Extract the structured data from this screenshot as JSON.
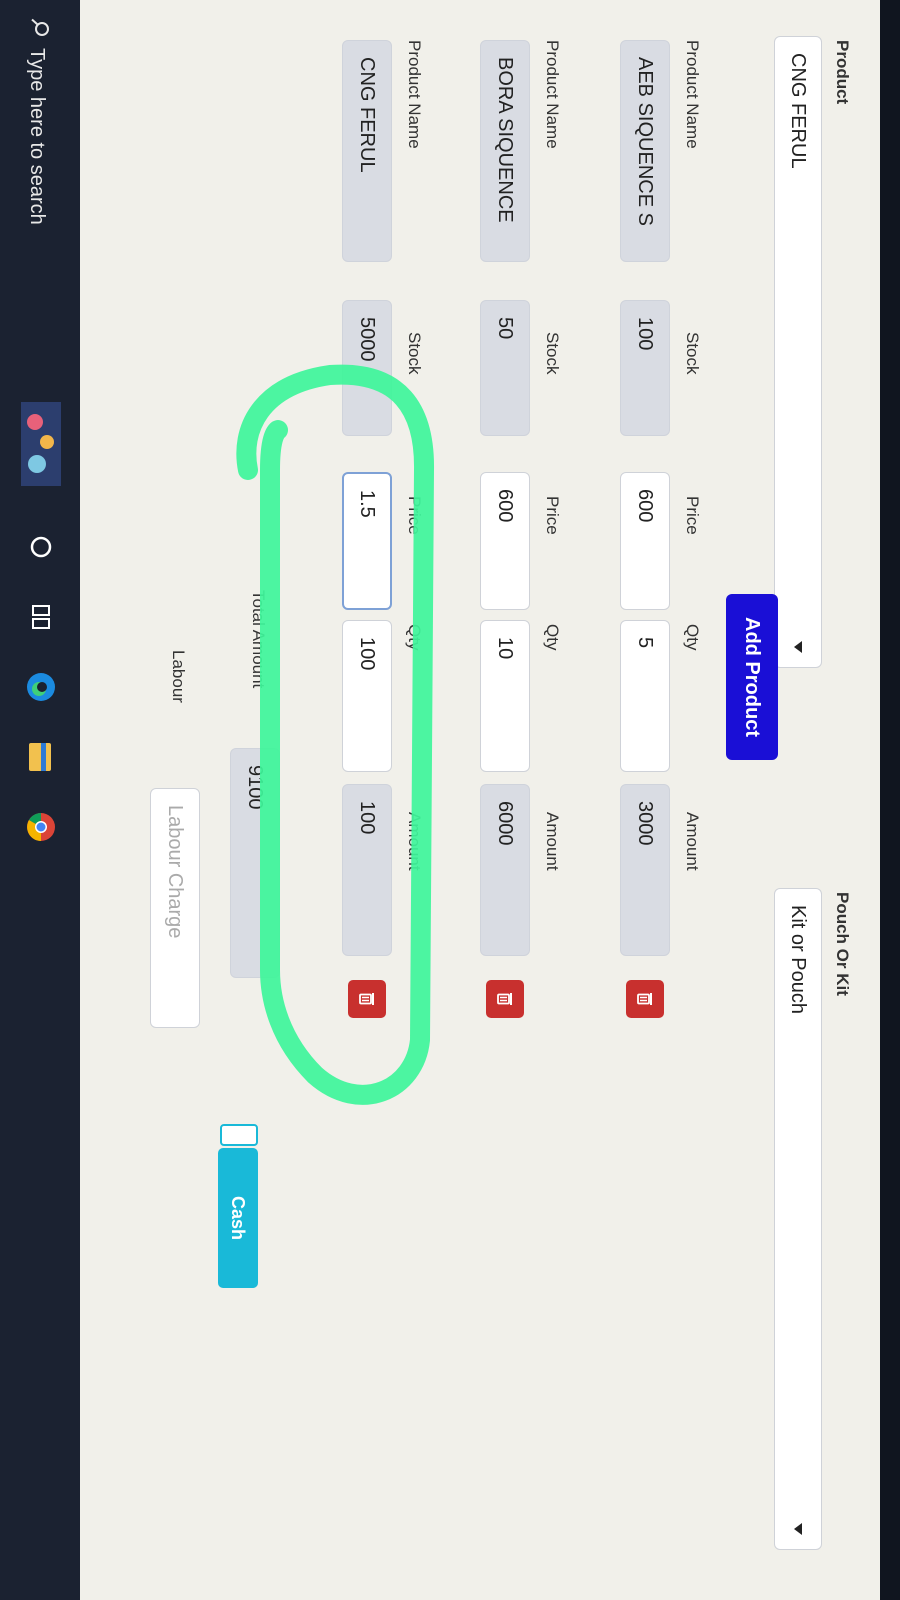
{
  "form": {
    "product_label": "Product",
    "product_value": "CNG FERUL",
    "pouch_label": "Pouch Or Kit",
    "pouch_value": "Kit or Pouch",
    "add_button": "Add Product"
  },
  "columns": {
    "name": "Product Name",
    "stock": "Stock",
    "price": "Price",
    "qty": "Qty",
    "amount": "Amount"
  },
  "rows": [
    {
      "name": "AEB SIQUENCE S",
      "stock": "100",
      "price": "600",
      "qty": "5",
      "amount": "3000"
    },
    {
      "name": "BORA SIQUENCE",
      "stock": "50",
      "price": "600",
      "qty": "10",
      "amount": "6000"
    },
    {
      "name": "CNG FERUL",
      "stock": "5000",
      "price": "1.5",
      "qty": "100",
      "amount": "100"
    }
  ],
  "totals": {
    "total_label": "Total Amount",
    "total_value": "9100",
    "labour_label": "Labour",
    "labour_placeholder": "Labour Charge"
  },
  "payment": {
    "cash_label": "Cash"
  },
  "taskbar": {
    "search_placeholder": "Type here to search"
  },
  "icons": [
    "search-icon",
    "trash-icon",
    "cortana-icon",
    "task-view-icon",
    "edge-icon",
    "file-explorer-icon",
    "chrome-icon",
    "dropdown-caret-icon"
  ],
  "colors": {
    "add_button": "#1a0fd6",
    "delete_button": "#c8302e",
    "cash_button": "#19b9d8",
    "annotation": "#3ef59a"
  }
}
